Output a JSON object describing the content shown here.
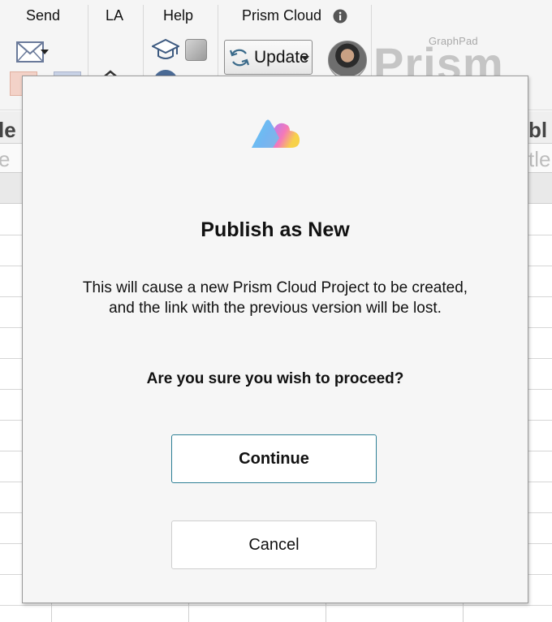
{
  "ribbon": {
    "groups": {
      "send": "Send",
      "la": "LA",
      "help": "Help",
      "prism_cloud": "Prism Cloud"
    },
    "update_label": "Update",
    "brand_sub": "GraphPad",
    "brand_main": "Prism"
  },
  "sheet": {
    "left_header_fragment": "le",
    "right_header_fragment": "bl",
    "left_hint_fragment": "e",
    "right_hint_fragment": "tle"
  },
  "dialog": {
    "title": "Publish as New",
    "message_line1": "This will cause a new Prism Cloud Project to be created,",
    "message_line2": "and the link with the previous version will be lost.",
    "question": "Are you sure you wish to proceed?",
    "continue_label": "Continue",
    "cancel_label": "Cancel"
  },
  "icons": {
    "info": "info-icon",
    "email": "email-icon",
    "learn": "graduation-cap-icon",
    "update": "refresh-icon",
    "cloud": "prism-cloud-logo"
  },
  "colors": {
    "dialog_bg": "#f6f6f6",
    "continue_border": "#2e7f95",
    "ribbon_bg": "#f5f5f5"
  }
}
